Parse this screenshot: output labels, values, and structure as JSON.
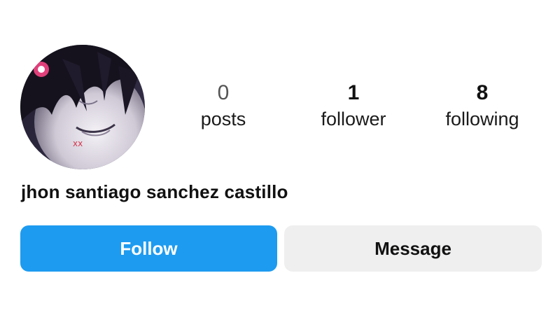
{
  "profile": {
    "name": "jhon santiago sanchez castillo",
    "avatar_icon": "profile-avatar-anime-face"
  },
  "stats": [
    {
      "count": "0",
      "label": "posts"
    },
    {
      "count": "1",
      "label": "follower"
    },
    {
      "count": "8",
      "label": "following"
    }
  ],
  "actions": {
    "follow_label": "Follow",
    "message_label": "Message"
  },
  "colors": {
    "follow_button": "#1d9bf0",
    "message_button": "#efeff0",
    "text": "#111111"
  }
}
